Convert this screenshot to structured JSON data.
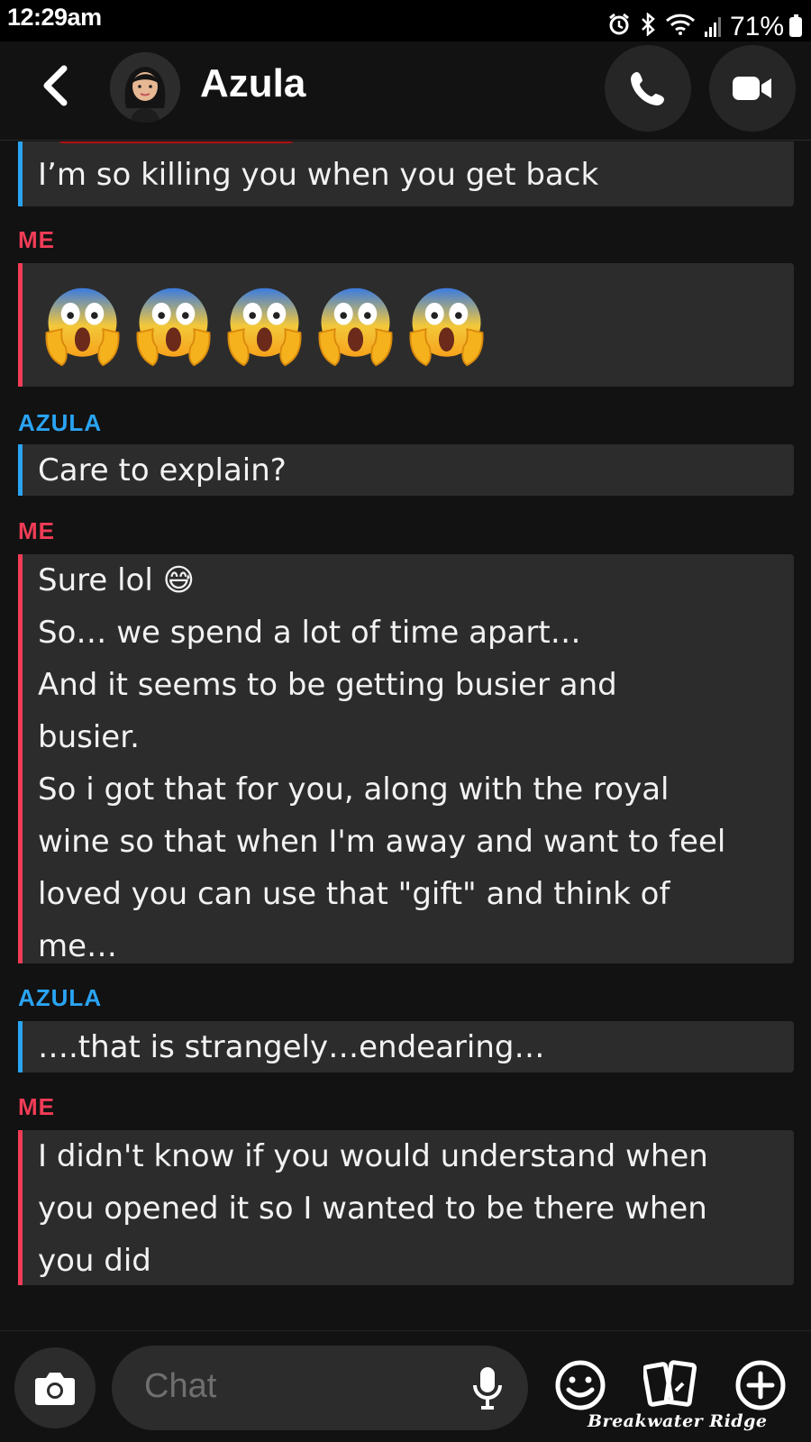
{
  "status_bar": {
    "time": "12:29am",
    "battery": "71%",
    "icons": [
      "alarm-icon",
      "bluetooth-icon",
      "wifi-icon",
      "signal-icon",
      "battery-icon"
    ]
  },
  "header": {
    "contact_name": "Azula",
    "icons": [
      "back-icon",
      "avatar",
      "phone-icon",
      "video-icon"
    ]
  },
  "messages": [
    {
      "sender": "",
      "type": "text",
      "text": "I’m so killing you when you get back",
      "image_text": "Breakwater Ridge"
    },
    {
      "sender": "ME",
      "type": "emoji",
      "emoji": "😱",
      "count": 5
    },
    {
      "sender": "AZULA",
      "type": "text",
      "text": "Care to explain?"
    },
    {
      "sender": "ME",
      "type": "text",
      "lines": [
        "Sure lol 😅",
        "So… we spend a lot of time apart…",
        "And it seems to be getting busier and",
        "busier.",
        "So i got that for you, along with the royal",
        "wine so that when I'm away and want to feel",
        "loved you can use that \"gift\" and think of",
        "me…"
      ]
    },
    {
      "sender": "AZULA",
      "type": "text",
      "text": "….that is strangely…endearing…"
    },
    {
      "sender": "ME",
      "type": "text",
      "lines": [
        "I didn't know if you would understand when",
        "you opened it so I wanted to be there when",
        "you did"
      ]
    }
  ],
  "composer": {
    "placeholder": "Chat",
    "icons": [
      "camera-icon",
      "microphone-icon",
      "emoji-icon",
      "cards-icon",
      "plus-icon"
    ]
  },
  "watermark": "Breakwater Ridge",
  "colors": {
    "me": "#f23c57",
    "azula": "#2aa4f4",
    "bubble": "#2c2c2c",
    "background": "#121212"
  }
}
